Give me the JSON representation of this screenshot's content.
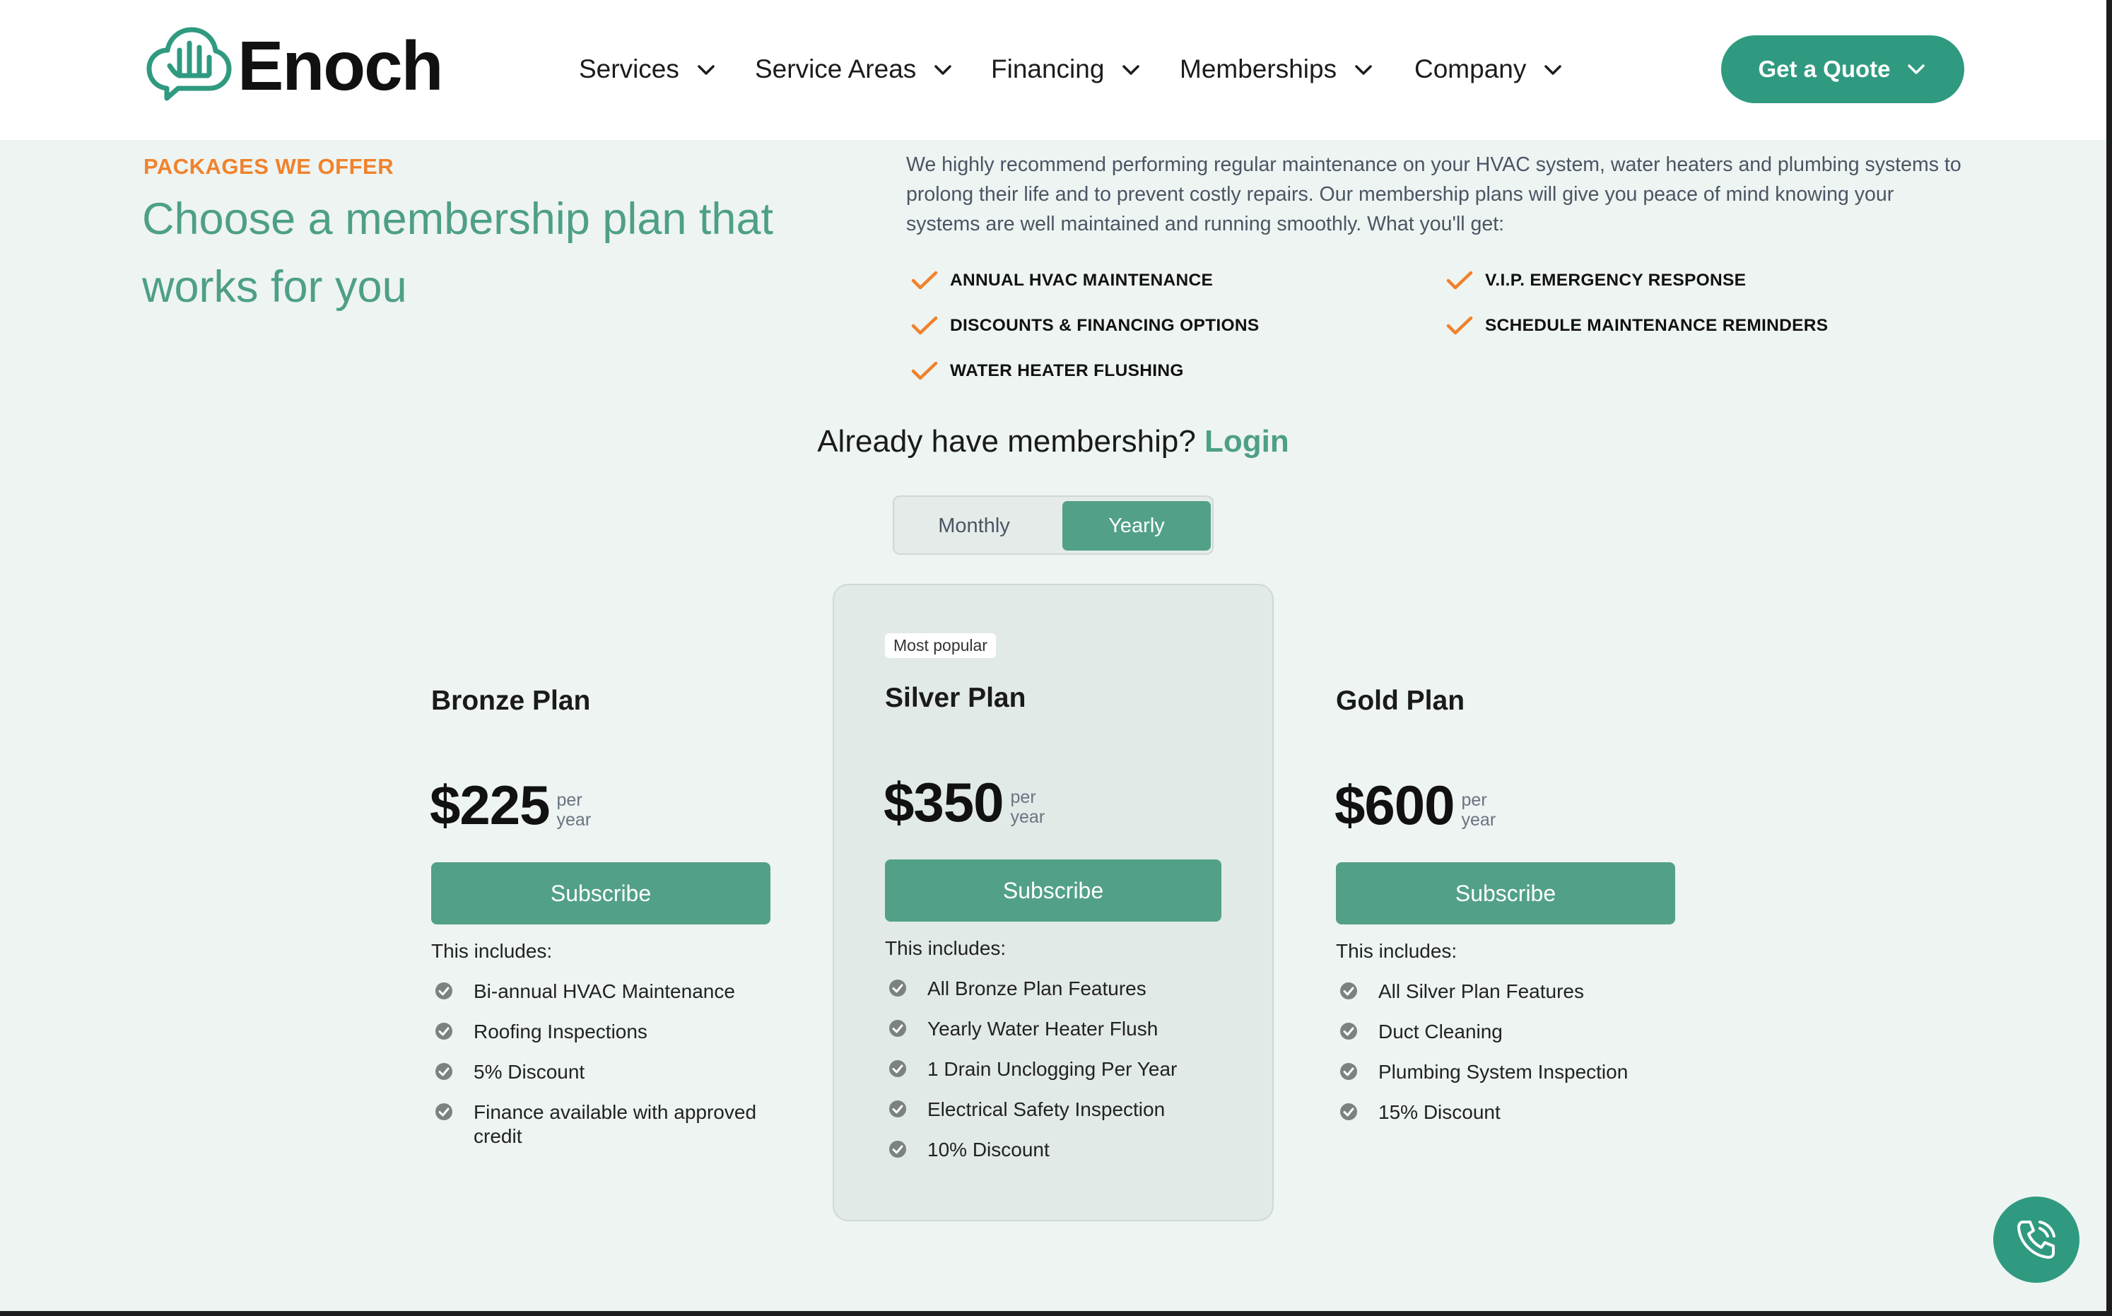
{
  "brand": {
    "name": "Enoch",
    "accent": "#2f9a80",
    "eyebrow_color": "#f0822c",
    "headline_color": "#4e9f87"
  },
  "nav": {
    "items": [
      {
        "label": "Services"
      },
      {
        "label": "Service Areas"
      },
      {
        "label": "Financing"
      },
      {
        "label": "Memberships"
      },
      {
        "label": "Company"
      }
    ],
    "cta_label": "Get a Quote"
  },
  "intro": {
    "eyebrow": "PACKAGES WE OFFER",
    "headline": "Choose a membership plan that works for you",
    "description": "We highly recommend performing regular maintenance on your HVAC system, water heaters and plumbing systems to prolong their life and to prevent costly repairs. Our membership plans will give you peace of mind knowing your systems are well maintained and running smoothly. What you'll get:",
    "benefits": [
      "ANNUAL HVAC MAINTENANCE",
      "V.I.P. EMERGENCY RESPONSE",
      "DISCOUNTS & FINANCING OPTIONS",
      "SCHEDULE MAINTENANCE REMINDERS",
      "WATER HEATER FLUSHING"
    ]
  },
  "login": {
    "prompt": "Already have membership?",
    "link": "Login"
  },
  "billing_toggle": {
    "options": [
      "Monthly",
      "Yearly"
    ],
    "selected": "Yearly"
  },
  "plans": [
    {
      "name": "Bronze Plan",
      "price": "$225",
      "per_1": "per",
      "per_2": "year",
      "button": "Subscribe",
      "includes_label": "This includes:",
      "features": [
        "Bi-annual HVAC Maintenance",
        "Roofing Inspections",
        "5% Discount",
        "Finance available with approved credit"
      ]
    },
    {
      "badge": "Most popular",
      "name": "Silver Plan",
      "price": "$350",
      "per_1": "per",
      "per_2": "year",
      "button": "Subscribe",
      "includes_label": "This includes:",
      "features": [
        "All Bronze Plan Features",
        "Yearly Water Heater Flush",
        "1 Drain Unclogging Per Year",
        "Electrical Safety Inspection",
        "10% Discount"
      ]
    },
    {
      "name": "Gold Plan",
      "price": "$600",
      "per_1": "per",
      "per_2": "year",
      "button": "Subscribe",
      "includes_label": "This includes:",
      "features": [
        "All Silver Plan Features",
        "Duct Cleaning",
        "Plumbing System Inspection",
        "15% Discount"
      ]
    }
  ],
  "icons": {
    "logo": "cloud-hand-icon",
    "dropdown": "chevron-down-icon",
    "benefit": "checkmark-icon",
    "feature": "check-circle-icon",
    "call": "phone-call-icon"
  }
}
